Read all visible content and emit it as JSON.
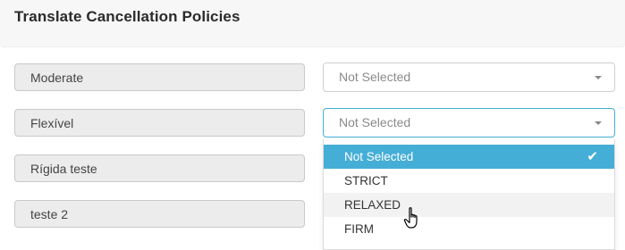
{
  "page": {
    "title": "Translate Cancellation Policies"
  },
  "rows": [
    {
      "label": "Moderate",
      "select_value": "Not Selected"
    },
    {
      "label": "Flexível",
      "select_value": "Not Selected"
    },
    {
      "label": "Rígida teste"
    },
    {
      "label": "teste 2"
    }
  ],
  "dropdown": {
    "options": [
      "Not Selected",
      "STRICT",
      "RELAXED",
      "FIRM"
    ],
    "selected": "Not Selected",
    "hovered": "RELAXED"
  },
  "colors": {
    "accent": "#45aed6",
    "field_bg": "#ececec",
    "header_bg": "#f7f7f7"
  },
  "icons": {
    "check": "check-icon",
    "caret": "chevron-down-icon",
    "cursor": "hand-pointer-icon"
  }
}
